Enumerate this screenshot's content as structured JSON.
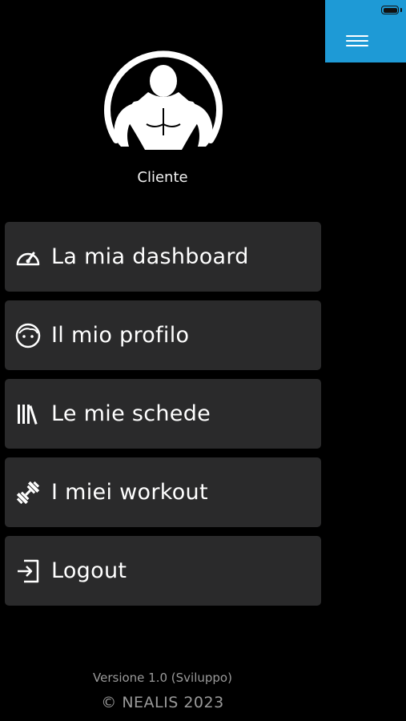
{
  "header": {
    "menu_icon": "hamburger-icon",
    "accent_color": "#1e9ad6"
  },
  "profile": {
    "avatar_icon": "bodybuilder-icon",
    "role": "Cliente"
  },
  "menu": {
    "items": [
      {
        "label": "La mia dashboard",
        "icon": "speedometer-icon"
      },
      {
        "label": "Il mio profilo",
        "icon": "face-icon"
      },
      {
        "label": "Le mie schede",
        "icon": "books-icon"
      },
      {
        "label": "I miei workout",
        "icon": "dumbbell-icon"
      },
      {
        "label": "Logout",
        "icon": "logout-icon"
      }
    ]
  },
  "footer": {
    "version": "Versione 1.0 (Sviluppo)",
    "copyright": "© NEALIS 2023"
  }
}
